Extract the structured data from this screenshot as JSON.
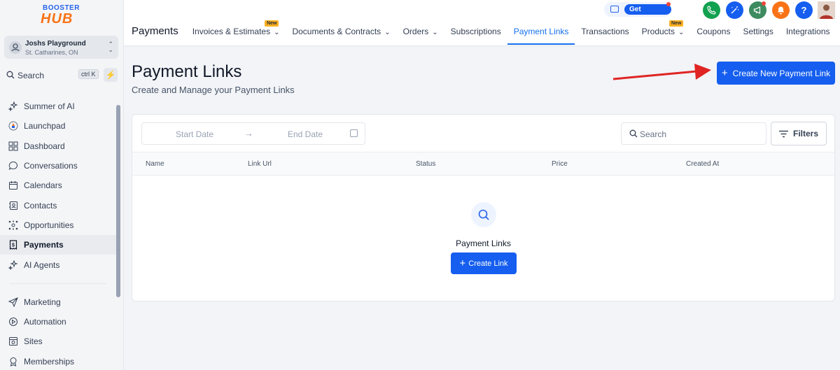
{
  "brand": {
    "logo_top": "BOOSTER",
    "logo_bottom": "HUB"
  },
  "account": {
    "name": "Joshs Playground",
    "location": "St. Catharines, ON"
  },
  "sidebar_search": {
    "label": "Search",
    "shortcut": "ctrl K"
  },
  "sidebar": {
    "items": [
      {
        "label": "Summer of AI",
        "icon": "sparkle-icon"
      },
      {
        "label": "Launchpad",
        "icon": "rocket-icon"
      },
      {
        "label": "Dashboard",
        "icon": "grid-icon"
      },
      {
        "label": "Conversations",
        "icon": "chat-icon"
      },
      {
        "label": "Calendars",
        "icon": "calendar-icon"
      },
      {
        "label": "Contacts",
        "icon": "contacts-icon"
      },
      {
        "label": "Opportunities",
        "icon": "network-icon"
      },
      {
        "label": "Payments",
        "icon": "receipt-icon",
        "active": true
      },
      {
        "label": "AI Agents",
        "icon": "sparkle-icon"
      }
    ],
    "items2": [
      {
        "label": "Marketing",
        "icon": "send-icon"
      },
      {
        "label": "Automation",
        "icon": "automation-icon"
      },
      {
        "label": "Sites",
        "icon": "sites-icon"
      },
      {
        "label": "Memberships",
        "icon": "award-icon"
      }
    ]
  },
  "header": {
    "section": "Payments",
    "tabs": [
      {
        "label": "Invoices & Estimates",
        "dropdown": true,
        "badge": "New"
      },
      {
        "label": "Documents & Contracts",
        "dropdown": true
      },
      {
        "label": "Orders",
        "dropdown": true
      },
      {
        "label": "Subscriptions"
      },
      {
        "label": "Payment Links",
        "active": true
      },
      {
        "label": "Transactions"
      },
      {
        "label": "Products",
        "dropdown": true,
        "badge": "New"
      },
      {
        "label": "Coupons"
      },
      {
        "label": "Settings"
      },
      {
        "label": "Integrations"
      }
    ],
    "get_started": "Get Started",
    "help": "?"
  },
  "page": {
    "title": "Payment Links",
    "subtitle": "Create and Manage your Payment Links",
    "create_button": "Create New Payment Link"
  },
  "filters": {
    "start_placeholder": "Start Date",
    "end_placeholder": "End Date",
    "search_placeholder": "Search",
    "filters_label": "Filters"
  },
  "table": {
    "columns": [
      "Name",
      "Link Url",
      "Status",
      "Price",
      "Created At"
    ]
  },
  "empty_state": {
    "title": "Payment Links",
    "button": "Create Link"
  },
  "colors": {
    "primary": "#155eef",
    "active_tab": "#1570ef",
    "arrow": "#e02424",
    "phone": "#12a150",
    "orange": "#f97316"
  }
}
